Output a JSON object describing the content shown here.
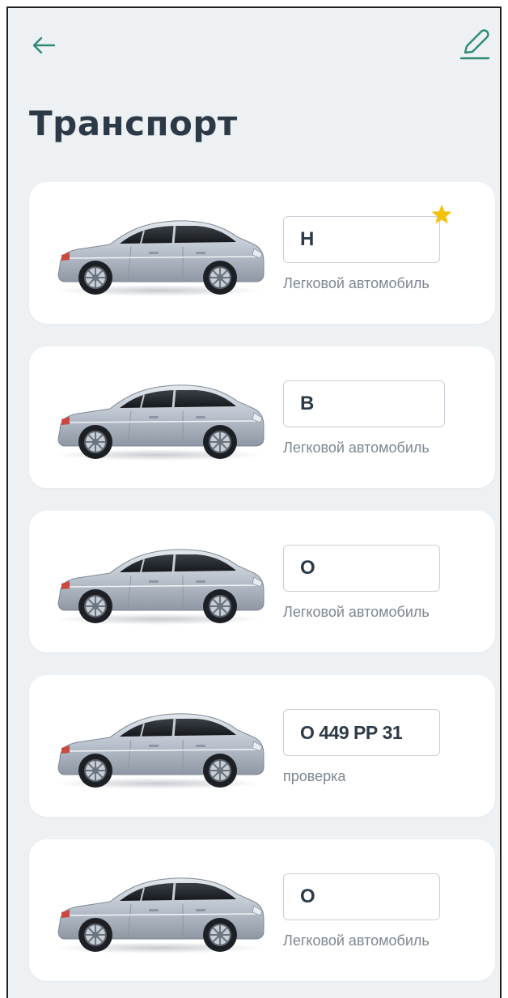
{
  "header": {
    "title": "Транспорт",
    "back_icon": "arrow-left-icon",
    "edit_icon": "pencil-icon"
  },
  "colors": {
    "accent": "#2e8a74",
    "star": "#f4c20d",
    "background": "#eef1f4",
    "card": "#ffffff",
    "title_text": "#2c3a47",
    "label_text": "#7d8791"
  },
  "vehicles": [
    {
      "plate": "Н",
      "label": "Легковой автомобиль",
      "favorite": true,
      "icon": "car-sedan-icon"
    },
    {
      "plate": "В",
      "label": "Легковой автомобиль",
      "favorite": false,
      "icon": "car-sedan-icon"
    },
    {
      "plate": "О",
      "label": "Легковой автомобиль",
      "favorite": false,
      "icon": "car-sedan-icon"
    },
    {
      "plate": "О 449 РР 31",
      "label": "проверка",
      "favorite": false,
      "icon": "car-sedan-icon"
    },
    {
      "plate": "О",
      "label": "Легковой автомобиль",
      "favorite": false,
      "icon": "car-sedan-icon"
    }
  ]
}
